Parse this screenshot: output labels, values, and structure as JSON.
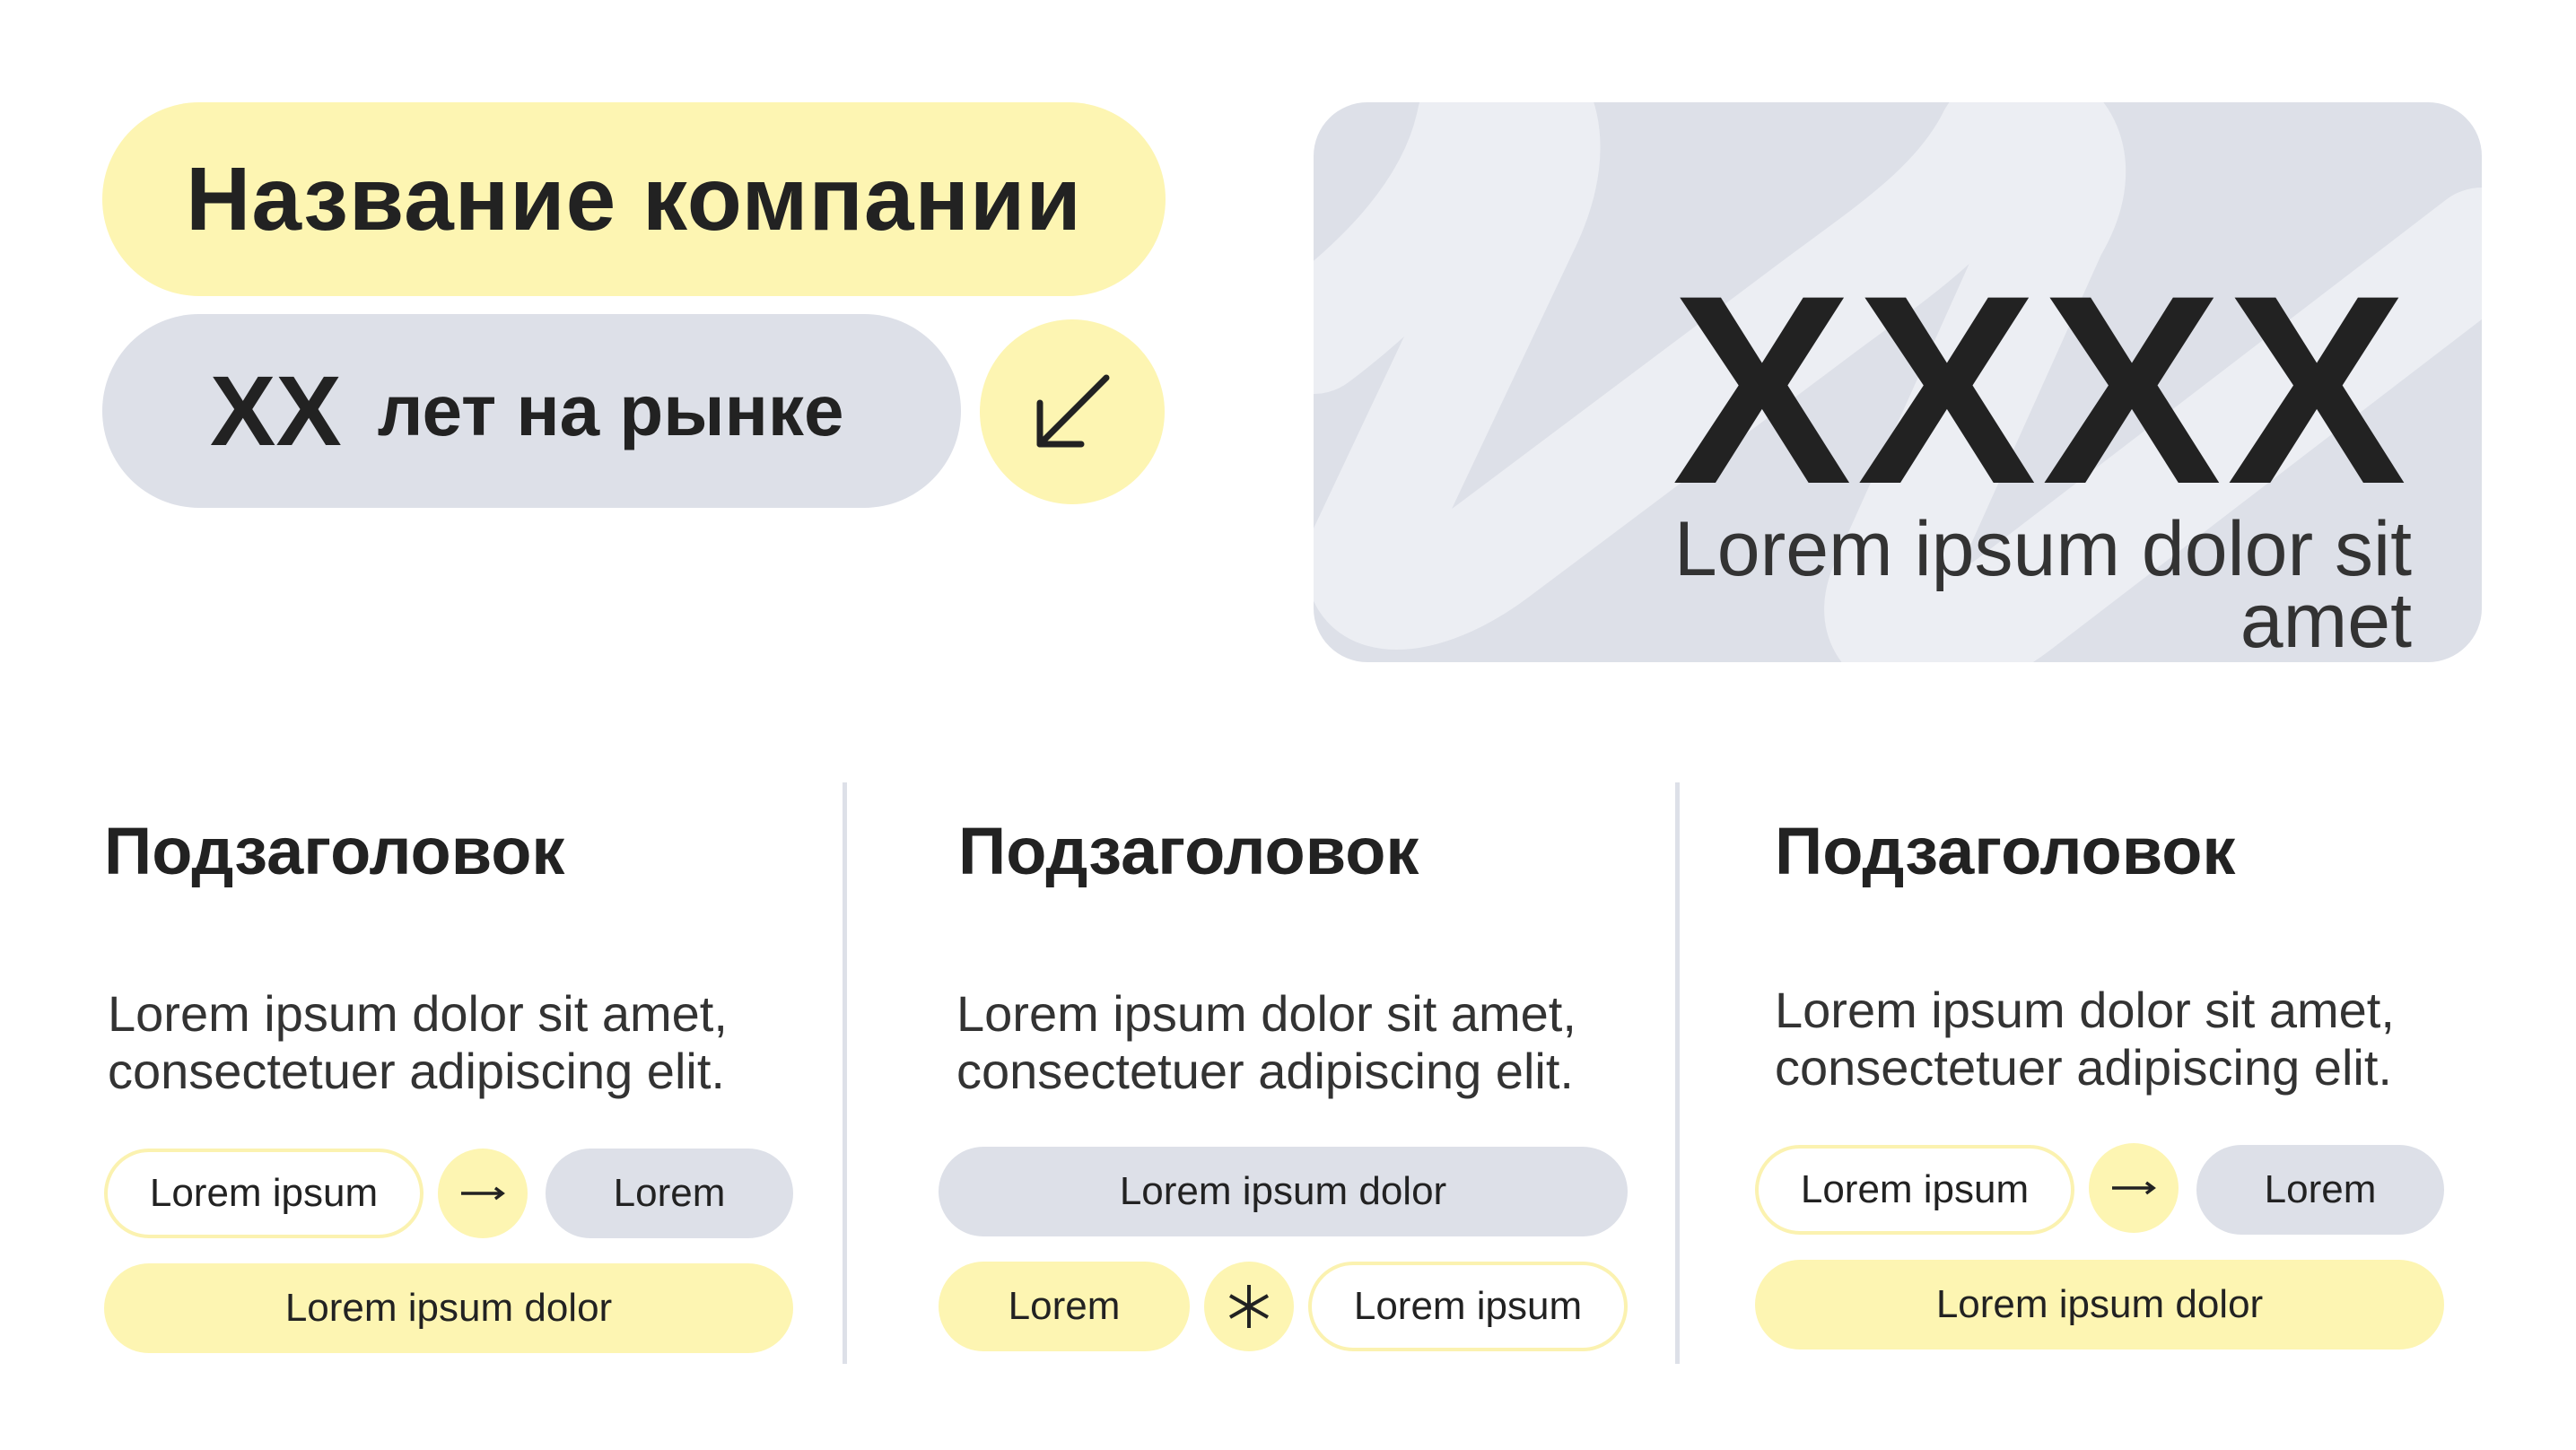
{
  "company": {
    "name": "Название компании",
    "years_number": "XX",
    "years_text": "лет на рынке",
    "arrow_icon": "arrow-down-left-icon"
  },
  "hero": {
    "number": "XXXX",
    "text": "Lorem ipsum dolor sit amet"
  },
  "colors": {
    "yellow": "#fdf5b2",
    "gray": "#dde0e8",
    "text": "#222222"
  },
  "columns": [
    {
      "heading": "Подзаголовок",
      "body": "Lorem ipsum dolor sit amet, consectetuer adipiscing elit.",
      "tags": [
        "Lorem ipsum",
        "Lorem",
        "Lorem ipsum dolor"
      ],
      "icon": "arrow-right-icon"
    },
    {
      "heading": "Подзаголовок",
      "body": "Lorem ipsum dolor sit amet, consectetuer adipiscing elit.",
      "tags": [
        "Lorem ipsum dolor",
        "Lorem",
        "Lorem ipsum"
      ],
      "icon": "asterisk-icon"
    },
    {
      "heading": "Подзаголовок",
      "body": "Lorem ipsum dolor sit amet, consectetuer adipiscing elit.",
      "tags": [
        "Lorem ipsum",
        "Lorem",
        "Lorem ipsum dolor"
      ],
      "icon": "arrow-right-icon"
    }
  ]
}
